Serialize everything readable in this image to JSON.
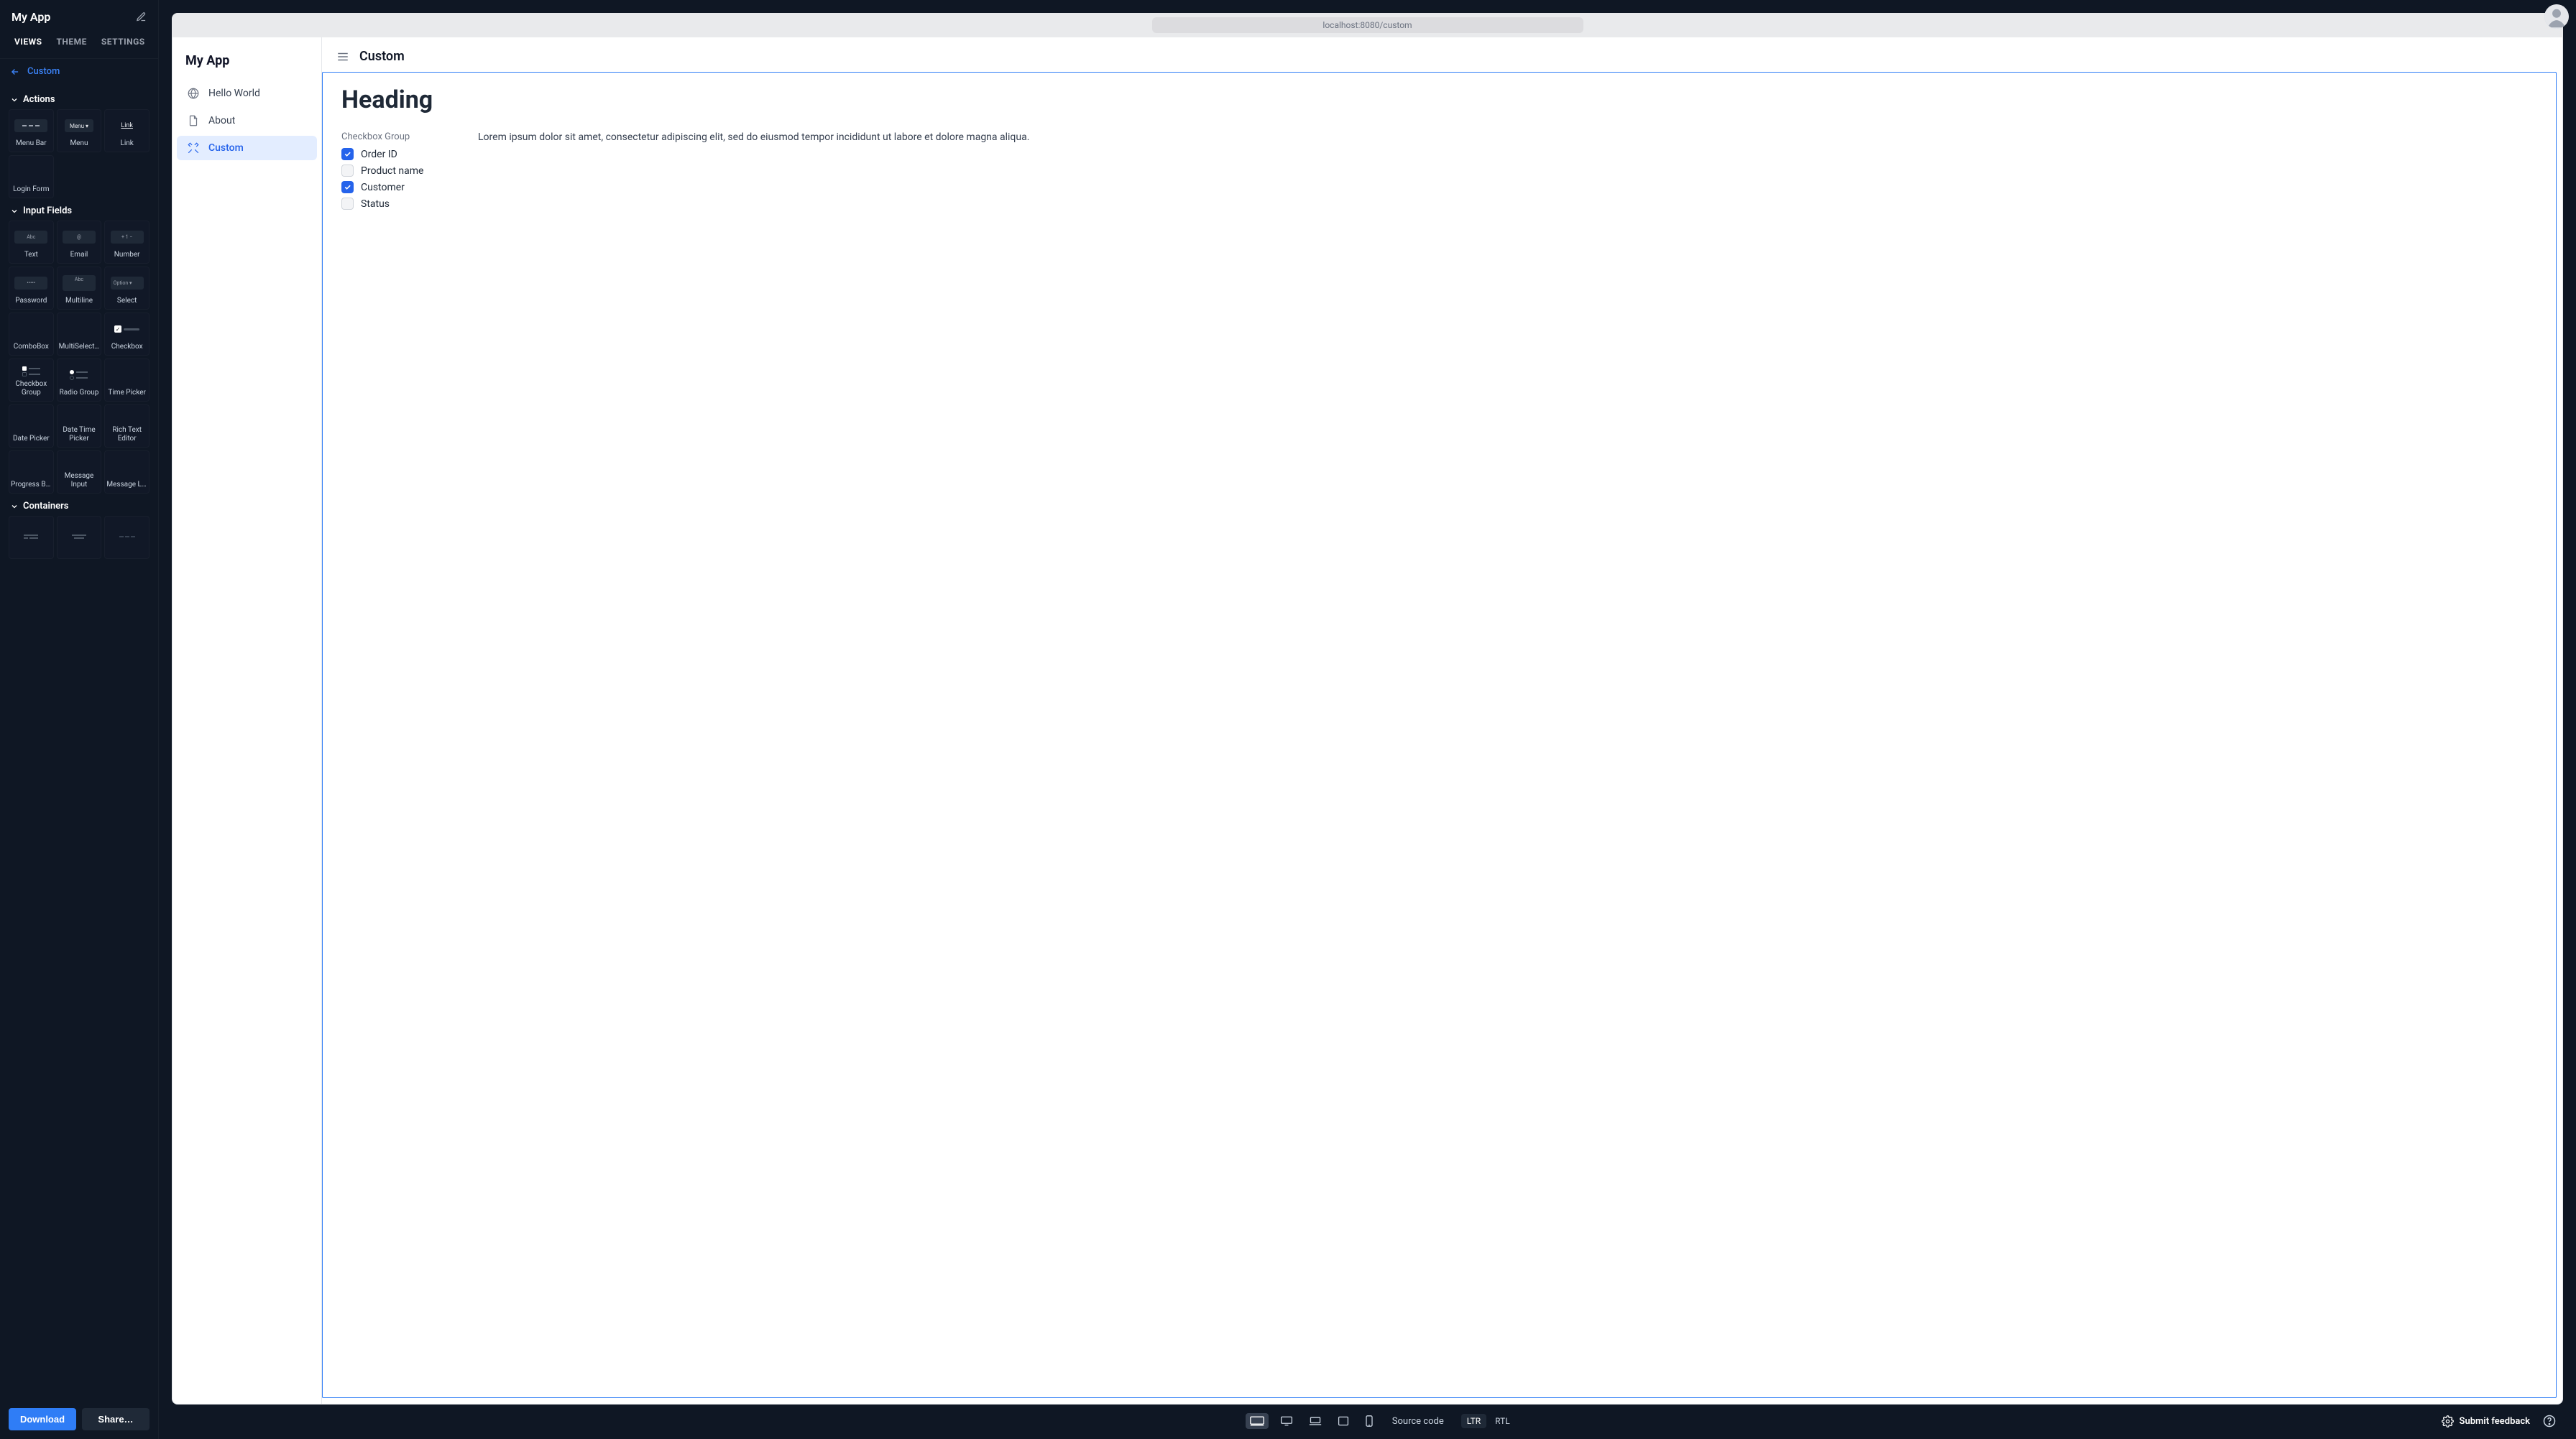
{
  "app": {
    "name": "My App"
  },
  "sidebarTabs": {
    "views": "VIEWS",
    "theme": "THEME",
    "settings": "SETTINGS",
    "active": "VIEWS"
  },
  "backLink": "Custom",
  "sections": {
    "actions": {
      "title": "Actions",
      "items": [
        "Menu Bar",
        "Menu",
        "Link",
        "Login Form"
      ]
    },
    "inputs": {
      "title": "Input Fields",
      "items": [
        "Text",
        "Email",
        "Number",
        "Password",
        "Multiline",
        "Select",
        "ComboBox",
        "MultiSelectCombo",
        "Checkbox",
        "Checkbox Group",
        "Radio Group",
        "Time Picker",
        "Date Picker",
        "Date Time Picker",
        "Rich Text Editor",
        "Progress Bar",
        "Message Input",
        "Message List"
      ]
    },
    "containers": {
      "title": "Containers"
    }
  },
  "footer": {
    "download": "Download",
    "share": "Share…"
  },
  "urlBar": "localhost:8080/custom",
  "previewSidebar": {
    "title": "My App",
    "items": [
      {
        "label": "Hello World",
        "icon": "globe"
      },
      {
        "label": "About",
        "icon": "document"
      },
      {
        "label": "Custom",
        "icon": "tools",
        "active": true
      }
    ]
  },
  "previewMain": {
    "viewTitle": "Custom",
    "heading": "Heading",
    "checkboxGroup": {
      "label": "Checkbox Group",
      "options": [
        {
          "label": "Order ID",
          "checked": true
        },
        {
          "label": "Product name",
          "checked": false
        },
        {
          "label": "Customer",
          "checked": true
        },
        {
          "label": "Status",
          "checked": false
        }
      ]
    },
    "paragraph": "Lorem ipsum dolor sit amet, consectetur adipiscing elit, sed do eiusmod tempor incididunt ut labore et dolore magna aliqua."
  },
  "bottomBar": {
    "sourceCode": "Source code",
    "ltr": "LTR",
    "rtl": "RTL",
    "feedback": "Submit feedback"
  }
}
